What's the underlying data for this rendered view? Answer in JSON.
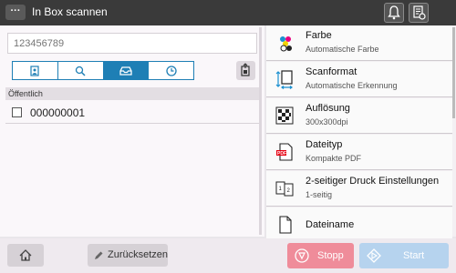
{
  "header": {
    "title": "In Box scannen",
    "menu_label": "···"
  },
  "search": {
    "placeholder": "123456789"
  },
  "tabs": [
    "user-box-icon",
    "search-icon",
    "tray-icon",
    "clock-icon"
  ],
  "list": {
    "group": "Öffentlich",
    "rows": [
      {
        "name": "000000001",
        "checked": false
      }
    ]
  },
  "settings": [
    {
      "label": "Farbe",
      "value": "Automatische  Farbe",
      "icon": "color-dots-icon"
    },
    {
      "label": "Scanformat",
      "value": "Automatische  Erkennung",
      "icon": "page-size-icon"
    },
    {
      "label": "Auflösung",
      "value": "300x300dpi",
      "icon": "checker-icon"
    },
    {
      "label": "Dateityp",
      "value": "Kompakte  PDF",
      "icon": "pdf-icon"
    },
    {
      "label": "2-seitiger  Druck  Einstellungen",
      "value": "1-seitig",
      "icon": "duplex-icon"
    },
    {
      "label": "Dateiname",
      "value": "",
      "icon": "document-icon"
    }
  ],
  "footer": {
    "reset": "Zurücksetzen",
    "stop": "Stopp",
    "start": "Start"
  },
  "colors": {
    "accent": "#1e7fb5",
    "stop": "#ef8c9a",
    "start": "#b6d3ee"
  }
}
